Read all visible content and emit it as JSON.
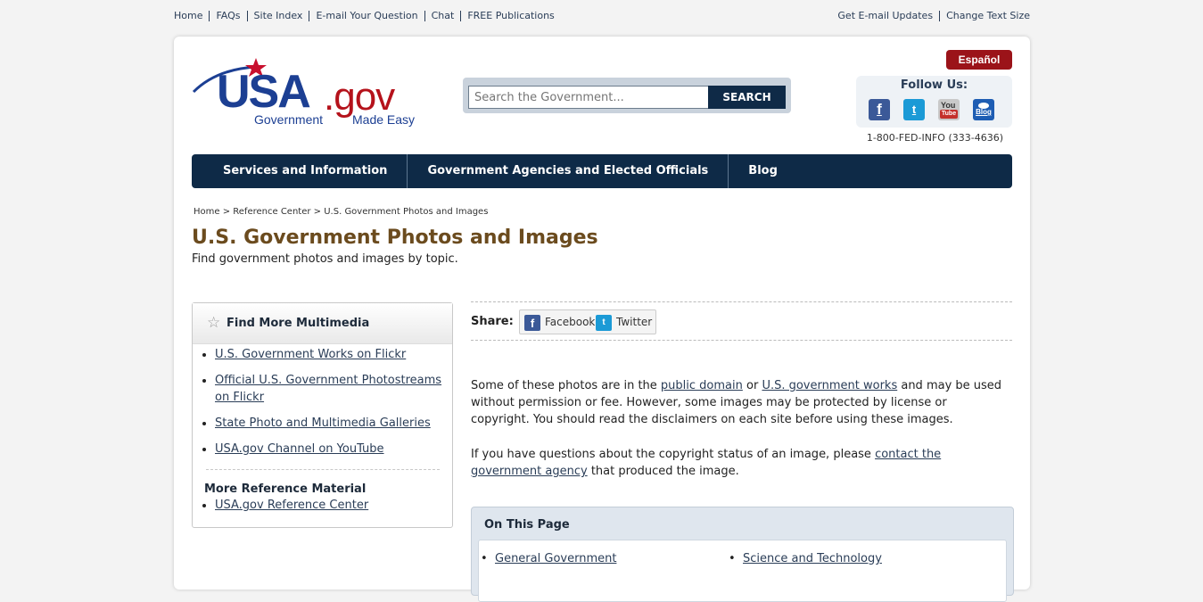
{
  "util_nav": {
    "left": [
      "Home",
      "FAQs",
      "Site Index",
      "E-mail Your Question",
      "Chat",
      "FREE Publications"
    ],
    "right": [
      "Get E-mail Updates",
      "Change Text Size"
    ]
  },
  "header": {
    "logo_usa": "USA",
    "logo_gov": ".gov",
    "logo_tag_1": "Government",
    "logo_tag_2": "Made Easy",
    "search_placeholder": "Search the Government...",
    "search_button": "SEARCH",
    "espanol": "Español",
    "follow_label": "Follow Us:",
    "social": {
      "facebook": "f",
      "twitter": "t",
      "youtube_top": "You",
      "youtube_bottom": "Tube",
      "blog": "Blog"
    },
    "phone": "1-800-FED-INFO (333-4636)"
  },
  "main_nav": [
    "Services and Information",
    "Government Agencies and Elected Officials",
    "Blog"
  ],
  "breadcrumb": {
    "home": "Home",
    "sep1": " > ",
    "ref": "Reference Center",
    "sep2": " > ",
    "current": "U.S. Government Photos and Images"
  },
  "page": {
    "title": "U.S. Government Photos and Images",
    "subtitle": "Find government photos and images by topic."
  },
  "sidebar": {
    "heading": "Find More Multimedia",
    "links": [
      "U.S. Government Works on Flickr",
      "Official U.S. Government Photostreams on Flickr",
      "State Photo and Multimedia Galleries",
      "USA.gov Channel on YouTube"
    ],
    "more_heading": "More Reference Material",
    "more_links": [
      "USA.gov Reference Center"
    ]
  },
  "share": {
    "label": "Share:",
    "facebook": "Facebook",
    "twitter": "Twitter"
  },
  "content": {
    "p1": {
      "a": "Some of these photos are in the ",
      "link1": "public domain",
      "b": " or ",
      "link2": "U.S. government works",
      "c": " and may be used without permission or fee. However, some images may be protected by license or copyright. You should read the disclaimers on each site before using these images."
    },
    "p2": {
      "a": "If you have questions about the copyright status of an image, please ",
      "link": "contact the government agency",
      "b": " that produced the image."
    }
  },
  "on_this_page": {
    "heading": "On This Page",
    "links": [
      "General Government",
      "Science and Technology"
    ]
  },
  "colors": {
    "brand_navy": "#0e2a47",
    "brand_red": "#b5121b",
    "title_brown": "#6b4b1e",
    "espanol_red": "#9b1319"
  }
}
